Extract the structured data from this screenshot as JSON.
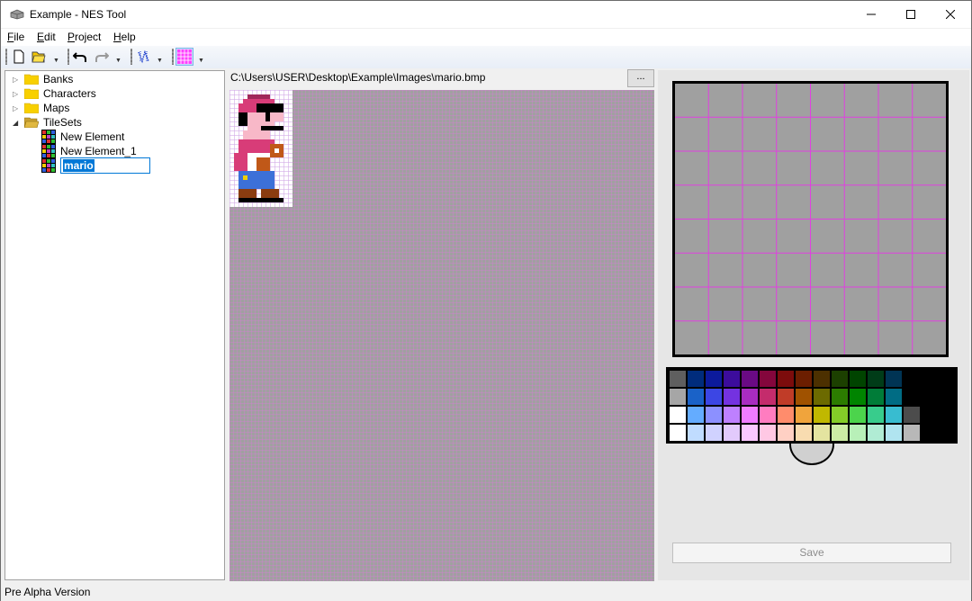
{
  "window": {
    "title": "Example - NES Tool"
  },
  "menu": [
    {
      "accel": "F",
      "rest": "ile"
    },
    {
      "accel": "E",
      "rest": "dit"
    },
    {
      "accel": "P",
      "rest": "roject"
    },
    {
      "accel": "H",
      "rest": "elp"
    }
  ],
  "tree": {
    "banks": "Banks",
    "characters": "Characters",
    "maps": "Maps",
    "tilesets": "TileSets",
    "element1": "New Element",
    "element2": "New Element_1",
    "editing": "mario"
  },
  "image": {
    "path": "C:\\Users\\USER\\Desktop\\Example\\Images\\mario.bmp",
    "browse_label": "..."
  },
  "palette": {
    "colors": [
      "#5f5f5f",
      "#002c7c",
      "#0c1a9c",
      "#3c0c9c",
      "#6a0a84",
      "#84063c",
      "#7c0c0c",
      "#6c1e00",
      "#4c3000",
      "#1c4000",
      "#004400",
      "#003c18",
      "#003454",
      "#000000",
      "#000000",
      "#000000",
      "#a6a6a6",
      "#1a62c8",
      "#3c46e4",
      "#7432e0",
      "#a82cc0",
      "#c42c6c",
      "#c03c28",
      "#a05200",
      "#6c6a00",
      "#2c7c00",
      "#008400",
      "#007c38",
      "#006c84",
      "#000000",
      "#000000",
      "#000000",
      "#ffffff",
      "#64acff",
      "#8c90ff",
      "#be80ff",
      "#f07cff",
      "#ff7cc0",
      "#ff8c6c",
      "#f0a43c",
      "#c0b800",
      "#84cc28",
      "#4cd44c",
      "#38cc8c",
      "#38bcd0",
      "#4c4c4c",
      "#000000",
      "#000000",
      "#ffffff",
      "#c0dcff",
      "#d0d2ff",
      "#e2cafc",
      "#fac8ff",
      "#ffc8e4",
      "#ffd0c4",
      "#f8dcb0",
      "#e4e4a0",
      "#cceca4",
      "#b8f0b8",
      "#b0ecd4",
      "#b0e4f0",
      "#b8b8b8",
      "#000000",
      "#000000"
    ]
  },
  "actions": {
    "save_label": "Save"
  },
  "status": {
    "text": "Pre Alpha Version"
  }
}
